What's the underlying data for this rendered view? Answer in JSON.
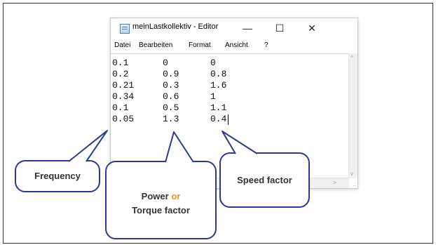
{
  "window": {
    "title": "meinLastkollektiv - Editor",
    "minimize_glyph": "—",
    "maximize_glyph": "☐",
    "close_glyph": "✕"
  },
  "menu": [
    "Datei",
    "Bearbeiten",
    "Format",
    "Ansicht",
    "?"
  ],
  "editor": {
    "rows": [
      [
        "0.1",
        "0",
        "0"
      ],
      [
        "0.2",
        "0.9",
        "0.8"
      ],
      [
        "0.21",
        "0.3",
        "1.6"
      ],
      [
        "0.34",
        "0.6",
        "1"
      ],
      [
        "0.1",
        "0.5",
        "1.1"
      ],
      [
        "0.05",
        "1.3",
        "0.4"
      ]
    ]
  },
  "scrollbars": {
    "up_arrow": "^",
    "down_arrow": "v",
    "right_arrow": ">",
    "grip": ".:"
  },
  "callouts": {
    "frequency": "Frequency",
    "power_word": "Power",
    "or_word": "or",
    "torque_factor": "Torque factor",
    "speed_factor": "Speed factor"
  },
  "colors": {
    "callout_border": "#2b3990",
    "accent_or": "#f7941d"
  }
}
